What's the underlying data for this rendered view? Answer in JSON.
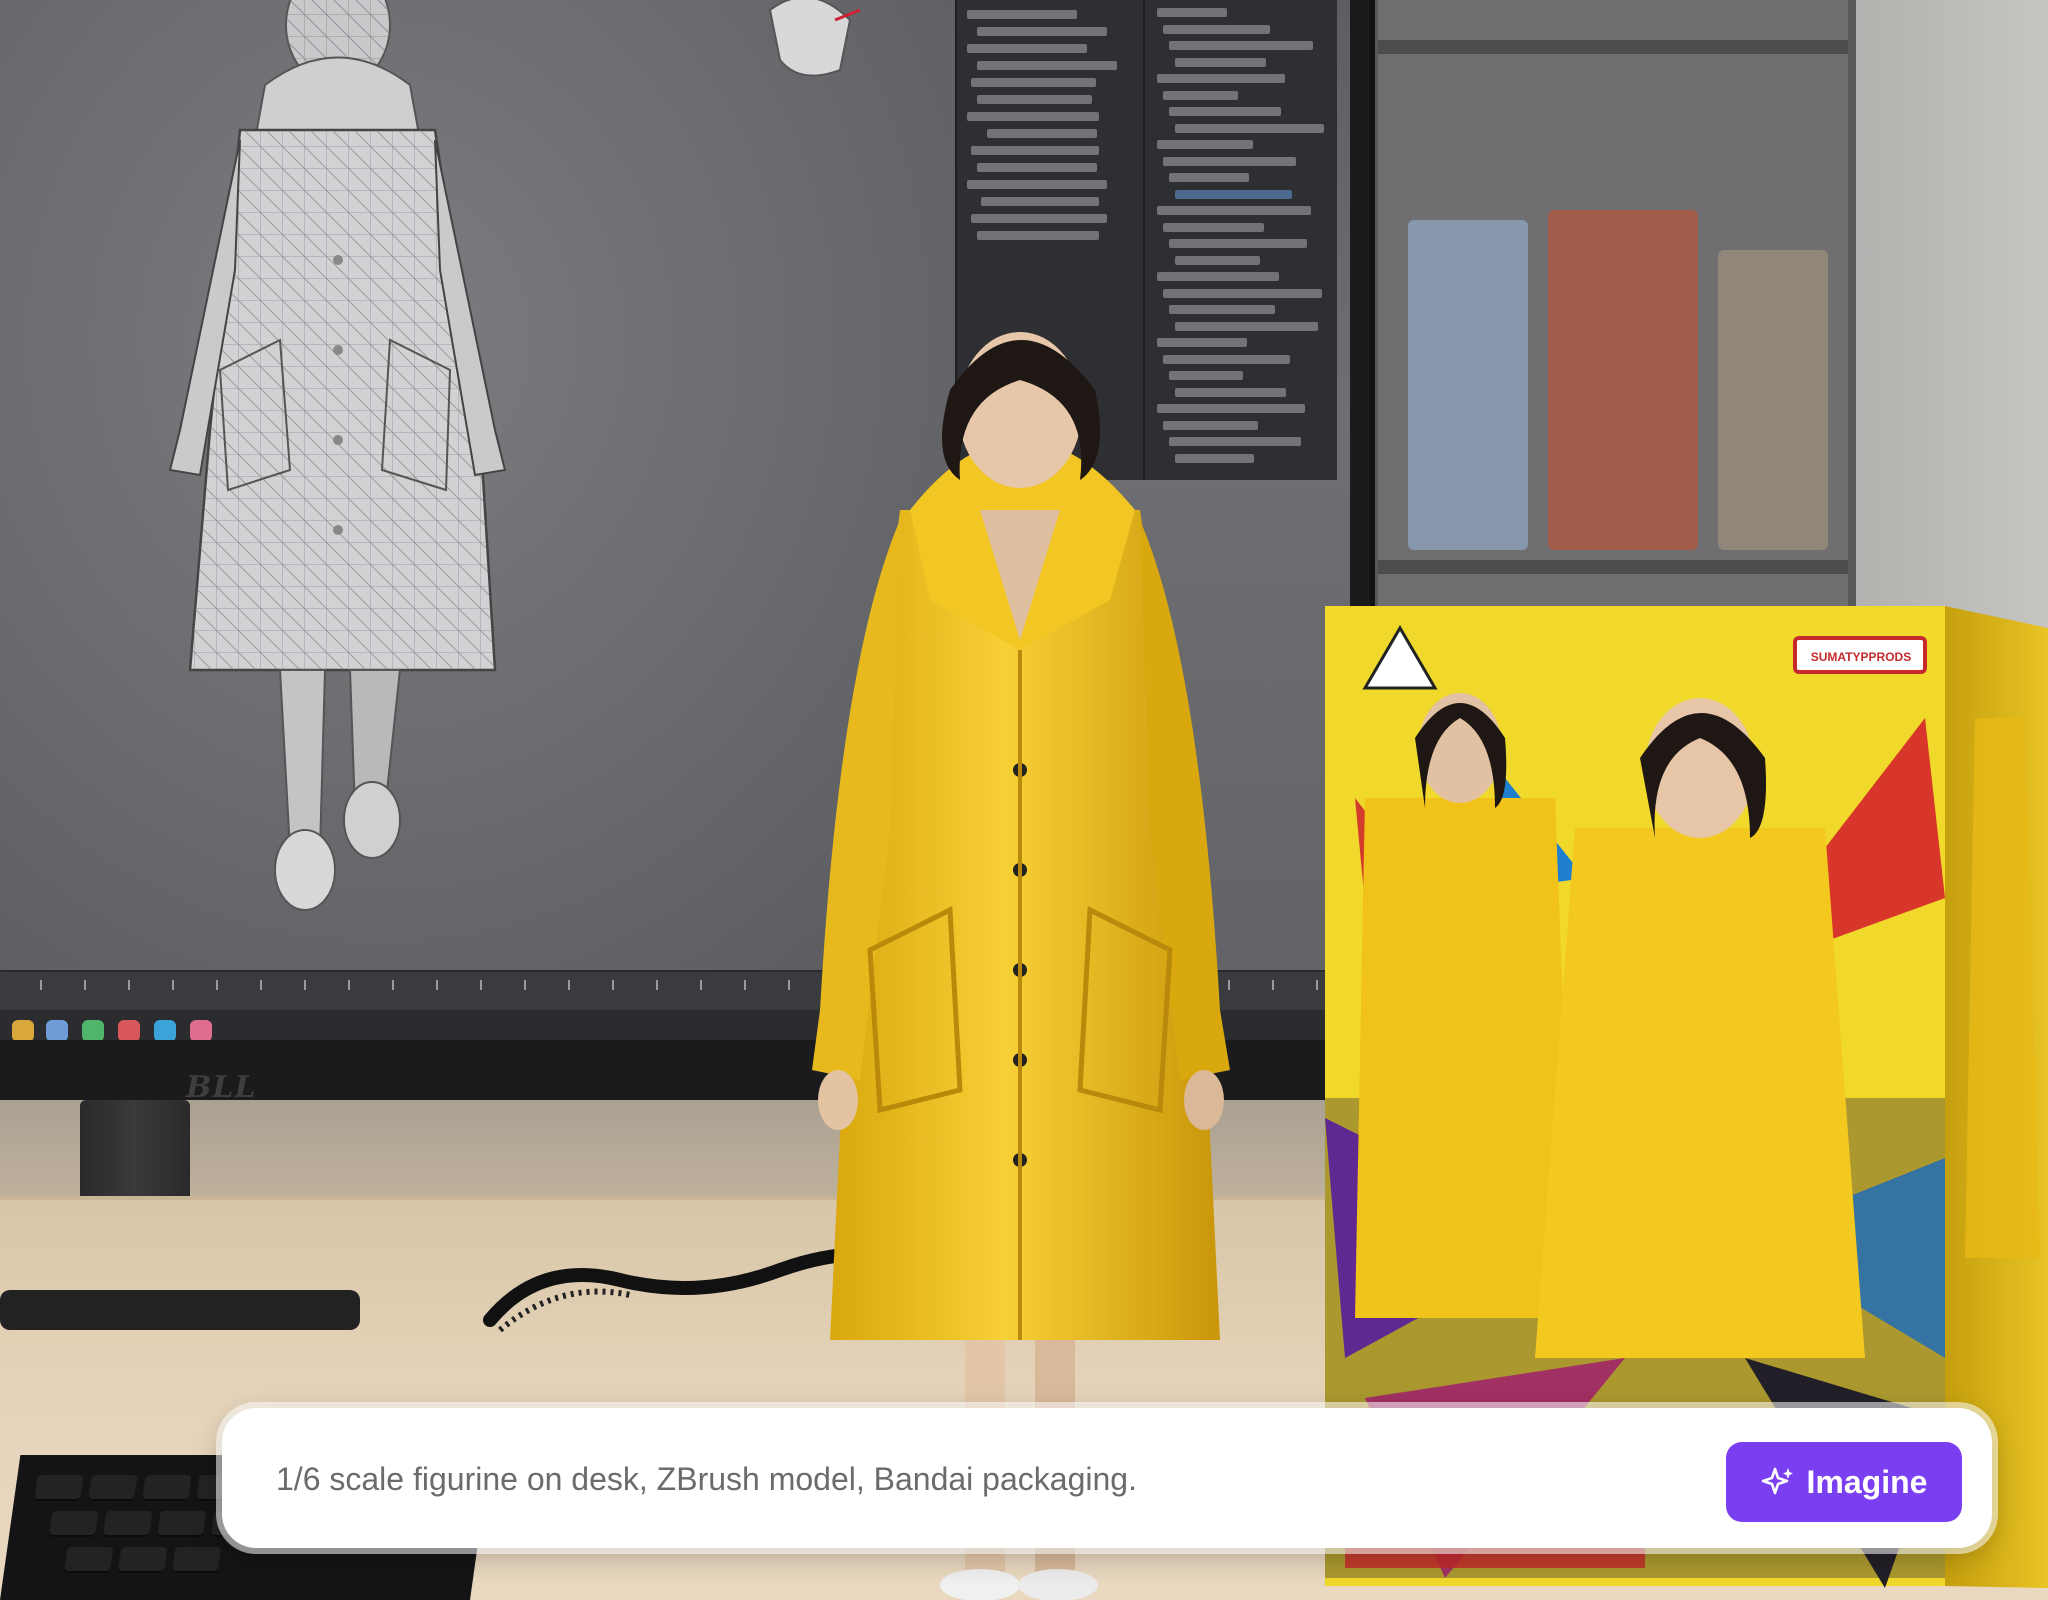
{
  "prompt": {
    "value": "1/6 scale figurine on desk, ZBrush model, Bandai packaging.",
    "placeholder": "1/6 scale figurine on desk, ZBrush model, Bandai packaging."
  },
  "imagine_button": {
    "label": "Imagine",
    "icon": "sparkle-icon",
    "color": "#7b3ff2"
  },
  "monitor": {
    "brand_logo": "BLL"
  },
  "box": {
    "corner_label": "SUMATYPPRODS"
  },
  "colors": {
    "raincoat_yellow": "#f3c81a",
    "accent_purple": "#7b3ff2",
    "background_gray": "#6e6f72"
  }
}
